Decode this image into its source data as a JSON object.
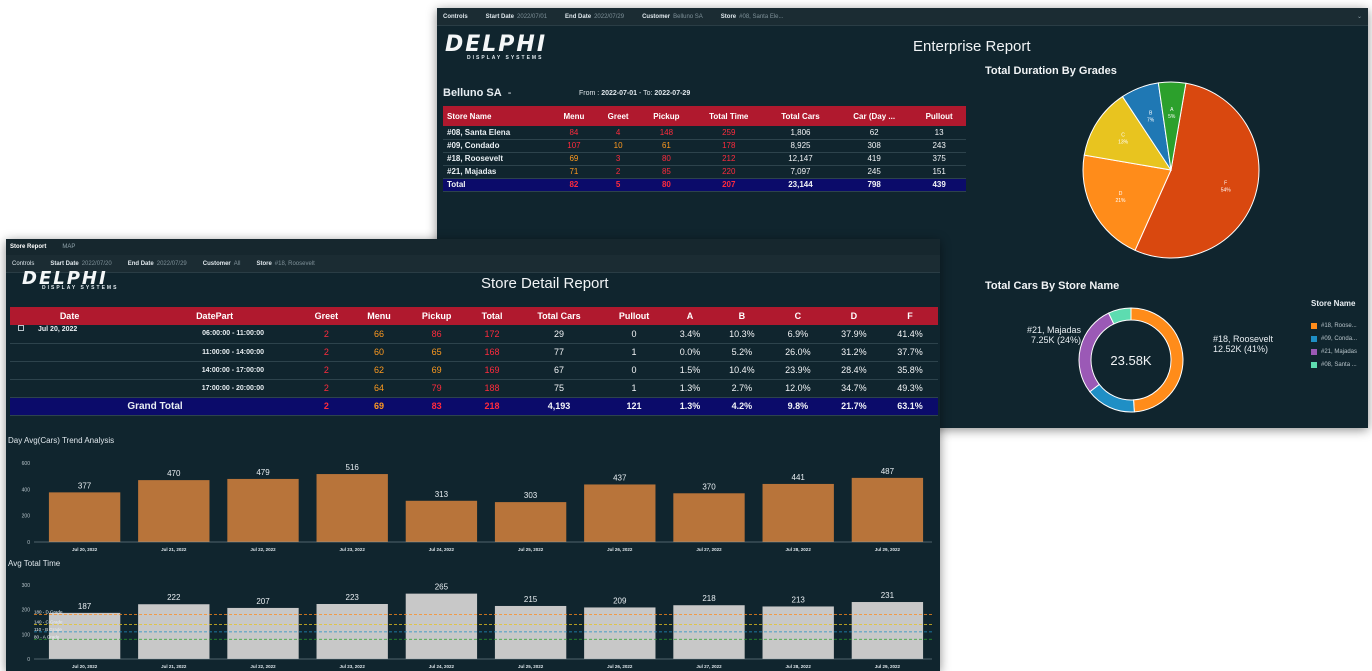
{
  "enterprise": {
    "controls": [
      {
        "key": "Controls",
        "value": ""
      },
      {
        "key": "Start Date",
        "value": "2022/07/01"
      },
      {
        "key": "End Date",
        "value": "2022/07/29"
      },
      {
        "key": "Customer",
        "value": "Belluno SA"
      },
      {
        "key": "Store",
        "value": "#08, Santa Ele..."
      }
    ],
    "logo": {
      "main": "DELPHI",
      "sub": "DISPLAY SYSTEMS"
    },
    "title": "Enterprise Report",
    "customer_name": "Belluno SA",
    "customer_dash": "-",
    "range_prefix": "From :",
    "range_from": "2022-07-01",
    "range_mid": "- To:",
    "range_to": "2022-07-29",
    "table": {
      "headers": [
        "Store Name",
        "Menu",
        "Greet",
        "Pickup",
        "Total Time",
        "Total Cars",
        "Car (Day ...",
        "Pullout"
      ],
      "rows": [
        [
          "#08, Santa Elena",
          "84",
          "4",
          "148",
          "259",
          "1,806",
          "62",
          "13"
        ],
        [
          "#09, Condado",
          "107",
          "10",
          "61",
          "178",
          "8,925",
          "308",
          "243"
        ],
        [
          "#18, Roosevelt",
          "69",
          "3",
          "80",
          "212",
          "12,147",
          "419",
          "375"
        ],
        [
          "#21, Majadas",
          "71",
          "2",
          "85",
          "220",
          "7,097",
          "245",
          "151"
        ]
      ],
      "total": [
        "Total",
        "82",
        "5",
        "80",
        "207",
        "23,144",
        "798",
        "439"
      ]
    },
    "pie_title": "Total Duration By Grades",
    "donut_title": "Total Cars By Store Name",
    "donut_center": "23.58K",
    "donut_label_left_1": "#21, Majadas",
    "donut_label_left_2": "7.25K (24%)",
    "donut_label_right_1": "#18, Roosevelt",
    "donut_label_right_2": "12.52K (41%)",
    "legend_title": "Store Name",
    "legend": [
      {
        "label": "#18, Roose...",
        "color": "#ff8c1a"
      },
      {
        "label": "#09, Conda...",
        "color": "#1f8fc5"
      },
      {
        "label": "#21, Majadas",
        "color": "#9b59b6"
      },
      {
        "label": "#08, Santa ...",
        "color": "#5ddcb0"
      }
    ]
  },
  "store": {
    "tabs": [
      "Store Report",
      "MAP"
    ],
    "controls": [
      {
        "key": "Controls",
        "value": ""
      },
      {
        "key": "Start Date",
        "value": "2022/07/20"
      },
      {
        "key": "End Date",
        "value": "2022/07/29"
      },
      {
        "key": "Customer",
        "value": "All"
      },
      {
        "key": "Store",
        "value": "#18, Roosevelt"
      }
    ],
    "logo": {
      "main": "DELPHI",
      "sub": "DISPLAY SYSTEMS"
    },
    "title": "Store Detail Report",
    "table": {
      "headers": [
        "Date",
        "DatePart",
        "Greet",
        "Menu",
        "Pickup",
        "Total",
        "Total Cars",
        "Pullout",
        "A",
        "B",
        "C",
        "D",
        "F"
      ],
      "date": "Jul 20, 2022",
      "rows": [
        [
          "06:00:00 - 11:00:00",
          "2",
          "66",
          "86",
          "172",
          "29",
          "0",
          "3.4%",
          "10.3%",
          "6.9%",
          "37.9%",
          "41.4%"
        ],
        [
          "11:00:00 - 14:00:00",
          "2",
          "60",
          "65",
          "168",
          "77",
          "1",
          "0.0%",
          "5.2%",
          "26.0%",
          "31.2%",
          "37.7%"
        ],
        [
          "14:00:00 - 17:00:00",
          "2",
          "62",
          "69",
          "169",
          "67",
          "0",
          "1.5%",
          "10.4%",
          "23.9%",
          "28.4%",
          "35.8%"
        ],
        [
          "17:00:00 - 20:00:00",
          "2",
          "64",
          "79",
          "188",
          "75",
          "1",
          "1.3%",
          "2.7%",
          "12.0%",
          "34.7%",
          "49.3%"
        ]
      ],
      "total_label": "Grand Total",
      "total": [
        "2",
        "69",
        "83",
        "218",
        "4,193",
        "121",
        "1.3%",
        "4.2%",
        "9.8%",
        "21.7%",
        "63.1%"
      ]
    },
    "bar1_title": "Day Avg(Cars) Trend Analysis",
    "bar2_title": "Avg Total Time",
    "grade_labels": [
      "180 - D Grade",
      "140 - C Grade",
      "110 - B Grade",
      "80 - A Grade"
    ]
  },
  "chart_data": [
    {
      "type": "pie",
      "title": "Total Duration By Grades",
      "categories": [
        "F",
        "D",
        "C",
        "B",
        "A"
      ],
      "values": [
        54,
        21,
        13,
        7,
        5
      ],
      "labels": [
        "54%",
        "21%",
        "13%",
        "7%",
        "5%"
      ],
      "colors": [
        "#d9480f",
        "#ff8c1a",
        "#e8c41f",
        "#1f78b4",
        "#2ca02c"
      ]
    },
    {
      "type": "pie",
      "title": "Total Cars By Store Name",
      "categories": [
        "#18, Roosevelt",
        "#09, Condado",
        "#21, Majadas",
        "#08, Santa Elena"
      ],
      "values": [
        12.52,
        3.98,
        7.25,
        1.81
      ],
      "colors": [
        "#ff8c1a",
        "#1f8fc5",
        "#9b59b6",
        "#5ddcb0"
      ]
    },
    {
      "type": "bar",
      "title": "Day Avg(Cars) Trend Analysis",
      "categories": [
        "Jul 20, 2022",
        "Jul 21, 2022",
        "Jul 22, 2022",
        "Jul 23, 2022",
        "Jul 24, 2022",
        "Jul 25, 2022",
        "Jul 26, 2022",
        "Jul 27, 2022",
        "Jul 28, 2022",
        "Jul 29, 2022"
      ],
      "values": [
        377,
        470,
        479,
        516,
        313,
        303,
        437,
        370,
        441,
        487
      ],
      "ylim": [
        0,
        600
      ],
      "yticks": [
        0,
        200,
        400,
        600
      ],
      "color": "#b8743a"
    },
    {
      "type": "bar",
      "title": "Avg Total Time",
      "categories": [
        "Jul 20, 2022",
        "Jul 21, 2022",
        "Jul 22, 2022",
        "Jul 23, 2022",
        "Jul 24, 2022",
        "Jul 25, 2022",
        "Jul 26, 2022",
        "Jul 27, 2022",
        "Jul 28, 2022",
        "Jul 29, 2022"
      ],
      "values": [
        187,
        222,
        207,
        223,
        265,
        215,
        209,
        218,
        213,
        231
      ],
      "ylim": [
        0,
        300
      ],
      "yticks": [
        0,
        100,
        200,
        300
      ],
      "color": "#c8c8c8",
      "reference_lines": [
        {
          "value": 180,
          "color": "#ff8c1a"
        },
        {
          "value": 140,
          "color": "#e8c41f"
        },
        {
          "value": 110,
          "color": "#1f8fc5"
        },
        {
          "value": 80,
          "color": "#2ca02c"
        }
      ]
    }
  ]
}
